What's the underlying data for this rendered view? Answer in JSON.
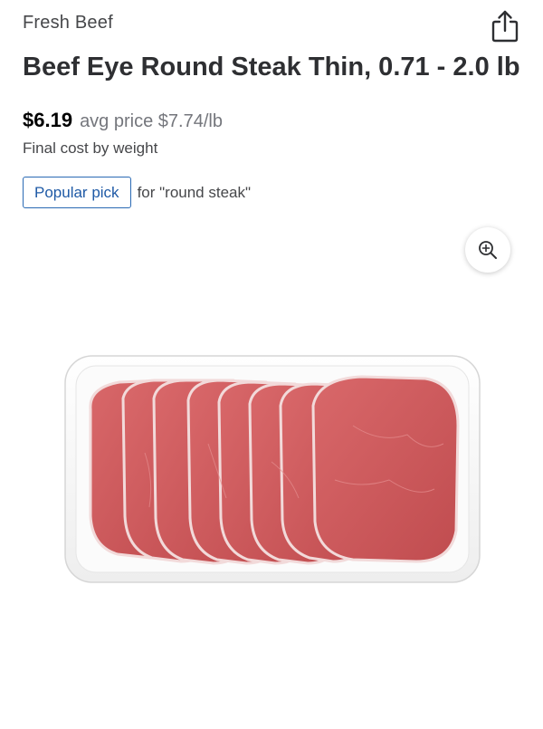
{
  "header": {
    "category": "Fresh Beef",
    "share_icon": "share-icon"
  },
  "product": {
    "title": "Beef Eye Round Steak Thin, 0.71 - 2.0 lb",
    "price": "$6.19",
    "avg_price": "avg price $7.74/lb",
    "final_cost_note": "Final cost by weight",
    "badge_label": "Popular pick",
    "badge_context": "for \"round steak\""
  },
  "image": {
    "zoom_icon": "zoom-in-icon",
    "colors": {
      "meat": "#cf5a5c",
      "meat_dark": "#b94446",
      "fat": "#f3dede",
      "tray": "#fafafa"
    }
  },
  "colors": {
    "badge_border": "#2a6ab4",
    "title_text": "#2e2f32",
    "muted_text": "#74767c"
  }
}
